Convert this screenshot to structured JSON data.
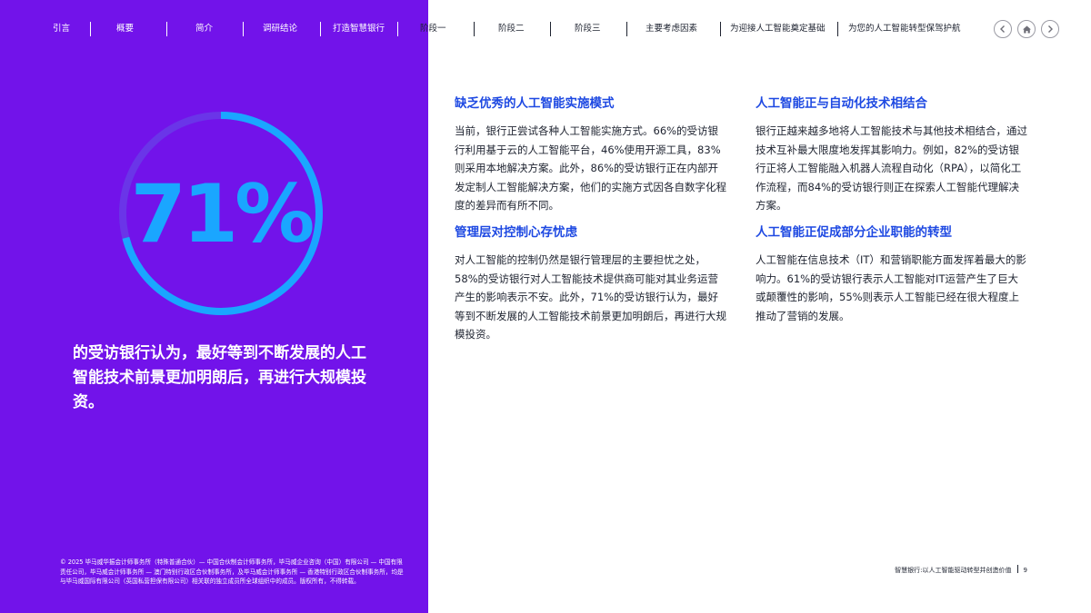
{
  "nav": {
    "items": [
      "引言",
      "概要",
      "简介",
      "调研结论",
      "打造智慧银行",
      "阶段一",
      "阶段二",
      "阶段三",
      "主要考虑因素",
      "为迎接人工智能奠定基础",
      "为您的人工智能转型保驾护航"
    ],
    "prev_icon": "chevron-left-icon",
    "home_icon": "home-icon",
    "next_icon": "chevron-right-icon"
  },
  "stat": {
    "value": "71%",
    "ring_fraction": 0.71,
    "caption": "的受访银行认为，最好等到不断发展的人工智能技术前景更加明朗后，再进行大规模投资。"
  },
  "sections": [
    {
      "heading": "缺乏优秀的人工智能实施模式",
      "body": "当前，银行正尝试各种人工智能实施方式。66%的受访银行利用基于云的人工智能平台，46%使用开源工具，83%则采用本地解决方案。此外，86%的受访银行正在内部开发定制人工智能解决方案，他们的实施方式因各自数字化程度的差异而有所不同。"
    },
    {
      "heading": "管理层对控制心存忧虑",
      "body": "对人工智能的控制仍然是银行管理层的主要担忧之处，58%的受访银行对人工智能技术提供商可能对其业务运营产生的影响表示不安。此外，71%的受访银行认为，最好等到不断发展的人工智能技术前景更加明朗后，再进行大规模投资。"
    },
    {
      "heading": "人工智能正与自动化技术相结合",
      "body": "银行正越来越多地将人工智能技术与其他技术相结合，通过技术互补最大限度地发挥其影响力。例如，82%的受访银行正将人工智能融入机器人流程自动化（RPA），以简化工作流程，而84%的受访银行则正在探索人工智能代理解决方案。"
    },
    {
      "heading": "人工智能正促成部分企业职能的转型",
      "body": "人工智能在信息技术（IT）和营销职能方面发挥着最大的影响力。61%的受访银行表示人工智能对IT运营产生了巨大或颠覆性的影响，55%则表示人工智能已经在很大程度上推动了营销的发展。"
    }
  ],
  "footer": {
    "copyright": "© 2025 毕马威华振会计师事务所（特殊普通合伙）— 中国合伙制会计师事务所，毕马威企业咨询（中国）有限公司 — 中国有限责任公司，毕马威会计师事务所 — 澳门特别行政区合伙制事务所，及毕马威会计师事务所 — 香港特别行政区合伙制事务所，均是与毕马威国际有限公司（英国私营担保有限公司）相关联的独立成员所全球组织中的成员。版权所有，不得转载。",
    "doc_title": "智慧银行:以人工智能驱动转型并创造价值",
    "page": "9"
  },
  "colors": {
    "purple": "#7213ea",
    "ring_blue": "#1aa6ff",
    "heading_blue": "#1e49e2"
  }
}
